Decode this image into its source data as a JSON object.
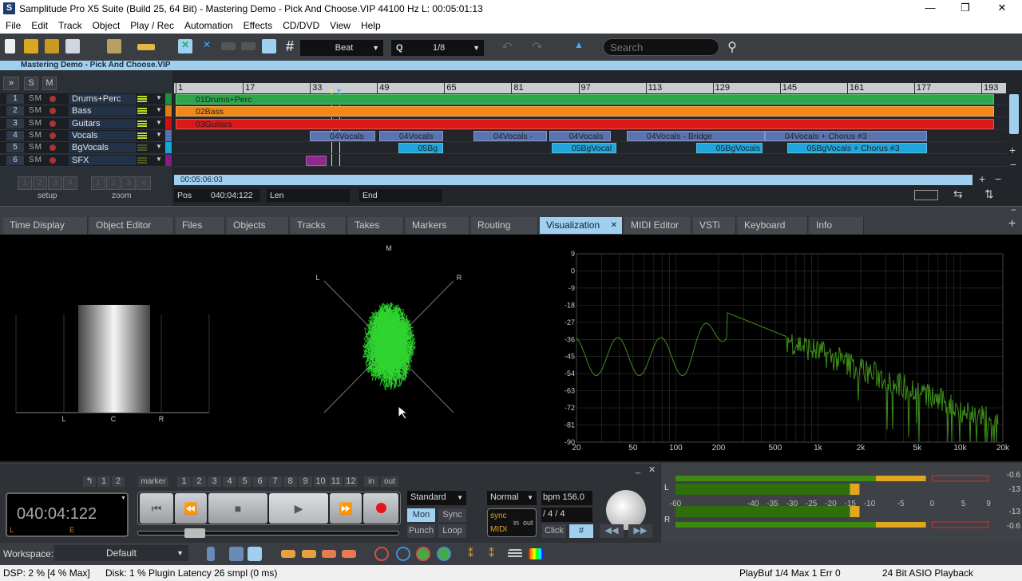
{
  "window": {
    "title": "Samplitude Pro X5 Suite (Build 25, 64 Bit)  -  Mastering Demo - Pick And Choose.VIP   44100 Hz L: 00:05:01:13",
    "logo": "S",
    "minimize": "—",
    "maximize": "❐",
    "close": "✕"
  },
  "menu": [
    "File",
    "Edit",
    "Track",
    "Object",
    "Play / Rec",
    "Automation",
    "Effects",
    "CD/DVD",
    "View",
    "Help"
  ],
  "toolbar": {
    "snap_mode": "Beat",
    "quantize_label": "Q",
    "quantize": "1/8",
    "search_placeholder": "Search",
    "grid_symbol": "#"
  },
  "project": {
    "title": "Mastering Demo - Pick And Choose.VIP",
    "solo": "S",
    "mute": "M",
    "expand": "»",
    "setup_label": "setup",
    "zoom_label": "zoom",
    "slots": [
      "1",
      "2",
      "3",
      "4"
    ],
    "position_time": "00:05:06:03",
    "pos_label": "Pos",
    "pos_value": "040:04:122",
    "len_label": "Len",
    "end_label": "End"
  },
  "ruler": [
    "1",
    "17",
    "33",
    "49",
    "65",
    "81",
    "97",
    "113",
    "129",
    "145",
    "161",
    "177",
    "193"
  ],
  "tracks": [
    {
      "num": "1",
      "name": "Drums+Perc",
      "color": "#1f8f3a",
      "clips": [
        {
          "label": "01Drums+Perc",
          "start": 1,
          "end": 196,
          "color": "#2aa84a"
        }
      ]
    },
    {
      "num": "2",
      "name": "Bass",
      "color": "#e07b10",
      "clips": [
        {
          "label": "02Bass",
          "start": 1,
          "end": 196,
          "color": "#ef8a1a"
        }
      ]
    },
    {
      "num": "3",
      "name": "Guitars",
      "color": "#d01010",
      "clips": [
        {
          "label": "03Guitars",
          "start": 1,
          "end": 196,
          "color": "#dd1818"
        }
      ]
    },
    {
      "num": "4",
      "name": "Vocals",
      "color": "#5572b0",
      "clips": [
        {
          "label": "04Vocals",
          "start": 33,
          "end": 48.6,
          "color": "#5a74b2"
        },
        {
          "label": "04Vocals",
          "start": 49.5,
          "end": 64.8,
          "color": "#5a74b2"
        },
        {
          "label": "04Vocals -",
          "start": 72,
          "end": 89.5,
          "color": "#5a74b2"
        },
        {
          "label": "04Vocals",
          "start": 90,
          "end": 104.7,
          "color": "#5a74b2"
        },
        {
          "label": "04Vocals - Bridge",
          "start": 108.5,
          "end": 141.4,
          "color": "#5a74b2"
        },
        {
          "label": "04Vocals + Chorus #3",
          "start": 141.4,
          "end": 180,
          "color": "#5a74b2"
        }
      ]
    },
    {
      "num": "5",
      "name": "BgVocals",
      "color": "#1aa5d8",
      "clips": [
        {
          "label": "05Bg",
          "start": 54,
          "end": 64.8,
          "color": "#20a6dc"
        },
        {
          "label": "05BgVocal",
          "start": 90.6,
          "end": 106,
          "color": "#20a6dc"
        },
        {
          "label": "05BgVocals",
          "start": 125,
          "end": 140.9,
          "color": "#20a6dc"
        },
        {
          "label": "05BgVocals + Chorus #3",
          "start": 146.7,
          "end": 180,
          "color": "#20a6dc"
        }
      ]
    },
    {
      "num": "6",
      "name": "SFX",
      "color": "#8a1a8a",
      "clips": [
        {
          "label": "",
          "start": 32,
          "end": 35,
          "color": "#8e2a8e"
        }
      ]
    }
  ],
  "track_controls": {
    "solo": "S",
    "mute": "M"
  },
  "tabs": [
    {
      "label": "Time Display"
    },
    {
      "label": "Object Editor"
    },
    {
      "label": "Files"
    },
    {
      "label": "Objects"
    },
    {
      "label": "Tracks"
    },
    {
      "label": "Takes"
    },
    {
      "label": "Markers"
    },
    {
      "label": "Routing"
    },
    {
      "label": "Visualization",
      "active": true,
      "close": "✕"
    },
    {
      "label": "MIDI Editor"
    },
    {
      "label": "VSTi"
    },
    {
      "label": "Keyboard"
    },
    {
      "label": "Info"
    }
  ],
  "visualization": {
    "stereo_meter": {
      "labels": [
        "L",
        "C",
        "R"
      ]
    },
    "goniometer": {
      "labels": {
        "m": "M",
        "l": "L",
        "r": "R"
      }
    },
    "spectrum": {
      "y_ticks": [
        "9",
        "0",
        "-9",
        "-18",
        "-27",
        "-36",
        "-45",
        "-54",
        "-63",
        "-72",
        "-81",
        "-90"
      ],
      "x_ticks": [
        "20",
        "50",
        "100",
        "200",
        "500",
        "1k",
        "2k",
        "5k",
        "10k",
        "20k"
      ],
      "color": "#3f8f1a"
    }
  },
  "transport": {
    "time": "040:04:122",
    "l_label": "L",
    "e_label": "E",
    "marker_label": "marker",
    "marker_nums": [
      "1",
      "2",
      "3",
      "4",
      "5",
      "6",
      "7",
      "8",
      "9",
      "10",
      "11",
      "12"
    ],
    "undo_nums": [
      "1",
      "2"
    ],
    "in": "in",
    "out": "out",
    "mode": "Standard",
    "mon": "Mon",
    "sync": "Sync",
    "punch": "Punch",
    "loop": "Loop",
    "play_mode": "Normal",
    "bpm": "bpm 156.0",
    "signature": "/   4 / 4",
    "sync_label": "sync",
    "midi_label": "MIDI",
    "in_label": "in",
    "out_label": "out",
    "click": "Click",
    "record_color": "#e8141c"
  },
  "meters": {
    "channels": [
      "L",
      "R"
    ],
    "scale": [
      "-60",
      "-40",
      "-35",
      "-30",
      "-25",
      "-20",
      "-15",
      "-10",
      "-5",
      "0",
      "5",
      "9"
    ],
    "peak_l": "-0.6",
    "rms_l": "-13",
    "rms_r": "-13",
    "peak_r": "-0.6",
    "level_l_db": -13,
    "level_r_db": -13
  },
  "workspace": {
    "label": "Workspace:",
    "value": "Default"
  },
  "status": {
    "dsp": "DSP: 2 %    [4 % Max]",
    "disk": "Disk:  1 %  Plugin Latency 26 smpl (0 ms)",
    "playbuf": "PlayBuf 1/4  Max 1  Err 0",
    "asio": "24 Bit ASIO Playback"
  }
}
